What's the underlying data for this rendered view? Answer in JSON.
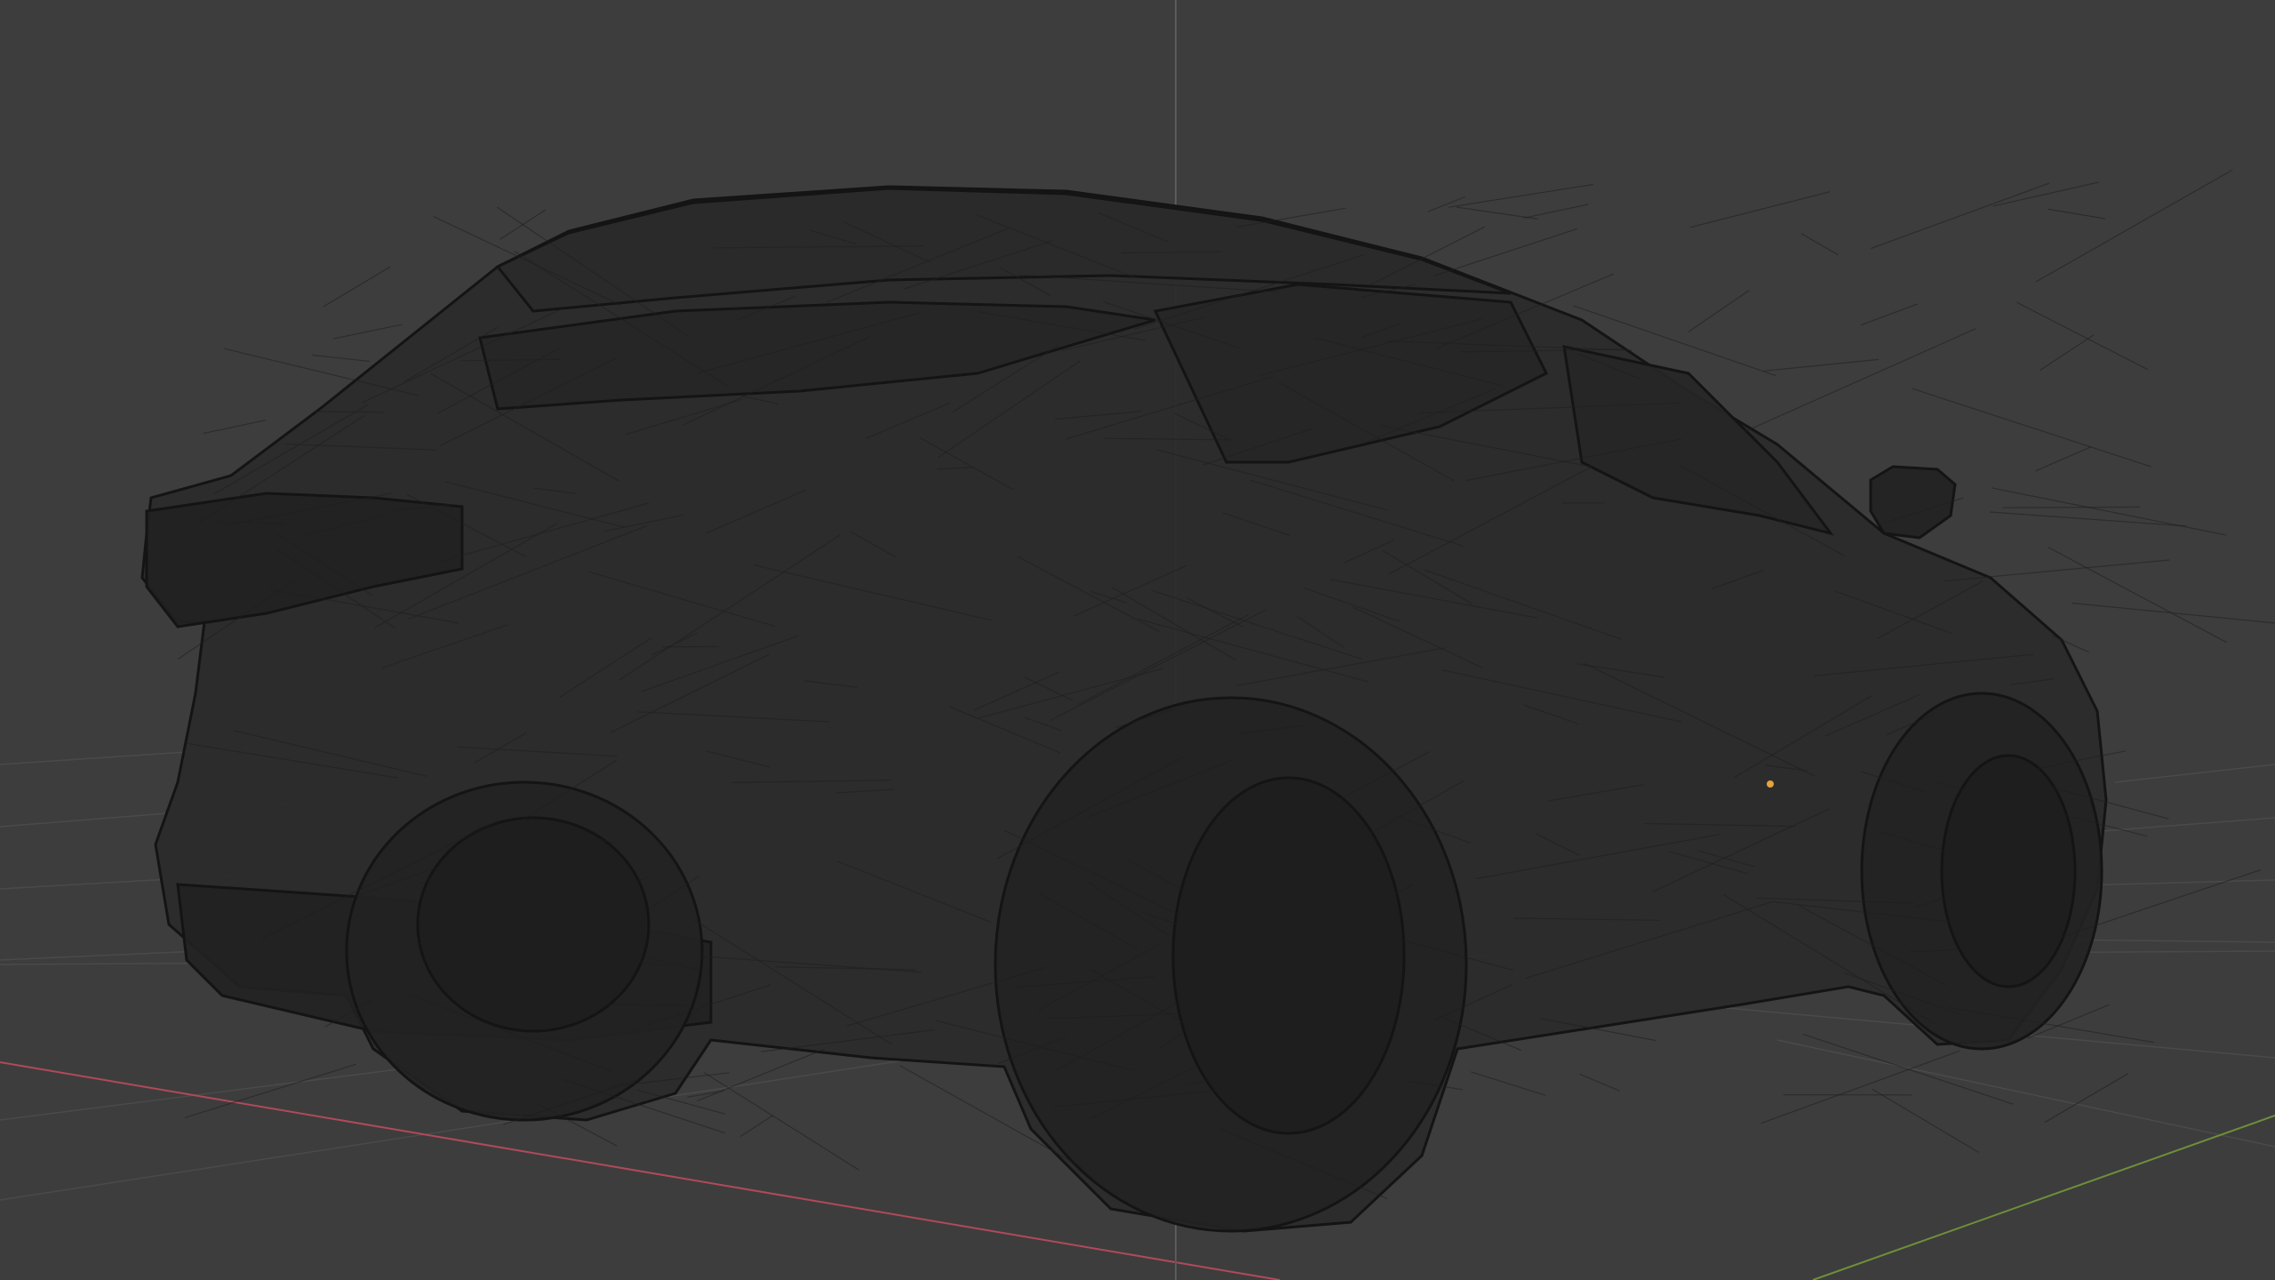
{
  "viewport": {
    "background_color": "#3d3d3d",
    "grid_color": "#4a4a4a",
    "x_axis_color": "#b04a5a",
    "y_axis_color": "#6f8f3a",
    "vertical_guide_color": "#5a5a5a",
    "mesh_color": "#1f1f1f",
    "mesh_fill_color": "#2a2a2a",
    "wire_color": "#141414",
    "origin_point_color": "#e8a33a"
  },
  "scene": {
    "object_name": "car-wireframe-model",
    "view_mode": "wireframe"
  }
}
